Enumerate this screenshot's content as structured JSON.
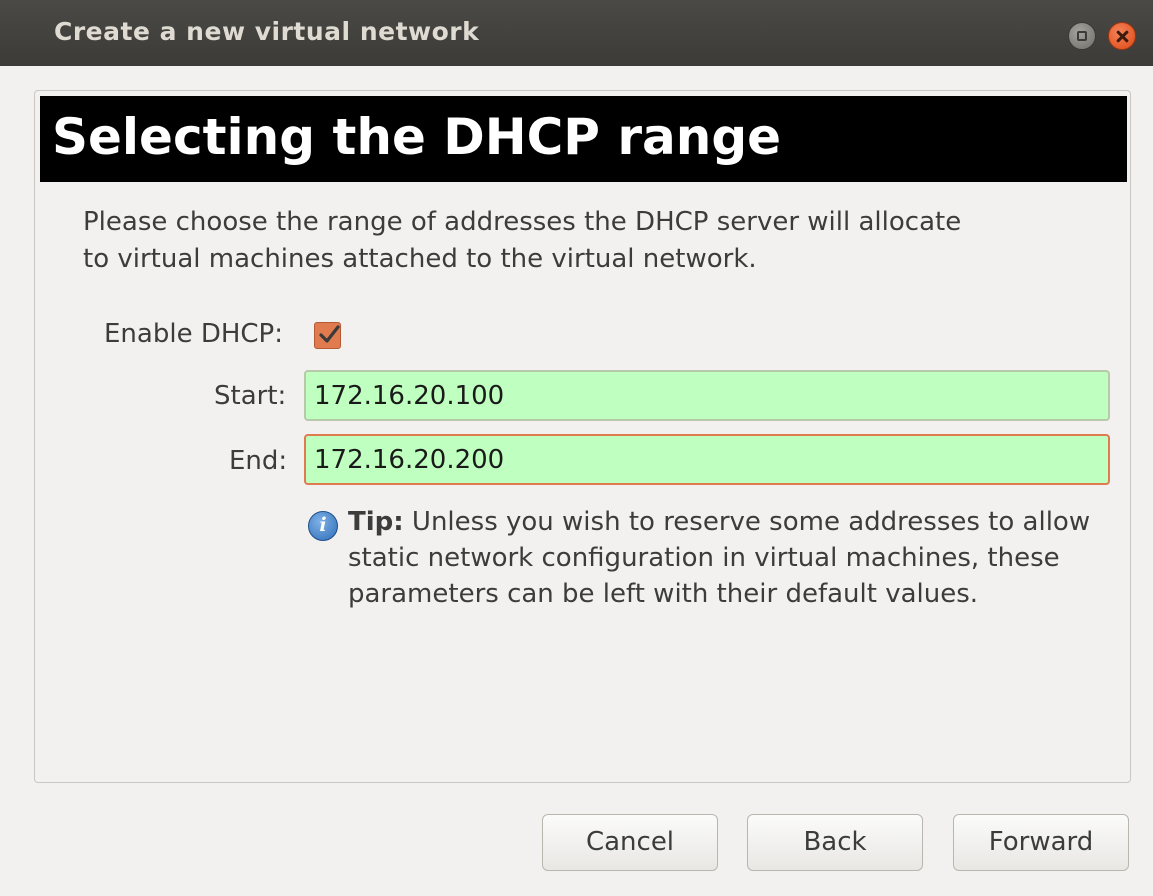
{
  "window": {
    "title": "Create a new virtual network"
  },
  "header": {
    "title": "Selecting the DHCP range"
  },
  "description": "Please choose the range of addresses the DHCP server will allocate to virtual machines attached to the virtual network.",
  "form": {
    "enable_dhcp_label": "Enable DHCP:",
    "enable_dhcp_checked": true,
    "start_label": "Start:",
    "start_value": "172.16.20.100",
    "end_label": "End:",
    "end_value": "172.16.20.200",
    "field_valid_color": "#bfffbf",
    "checkbox_color": "#e07a4f"
  },
  "tip": {
    "icon": "info-icon",
    "bold": "Tip:",
    "text": "Unless you wish to reserve some addresses to allow static network configuration in virtual machines, these parameters can be left with their default values."
  },
  "buttons": {
    "cancel": "Cancel",
    "back": "Back",
    "forward": "Forward"
  }
}
